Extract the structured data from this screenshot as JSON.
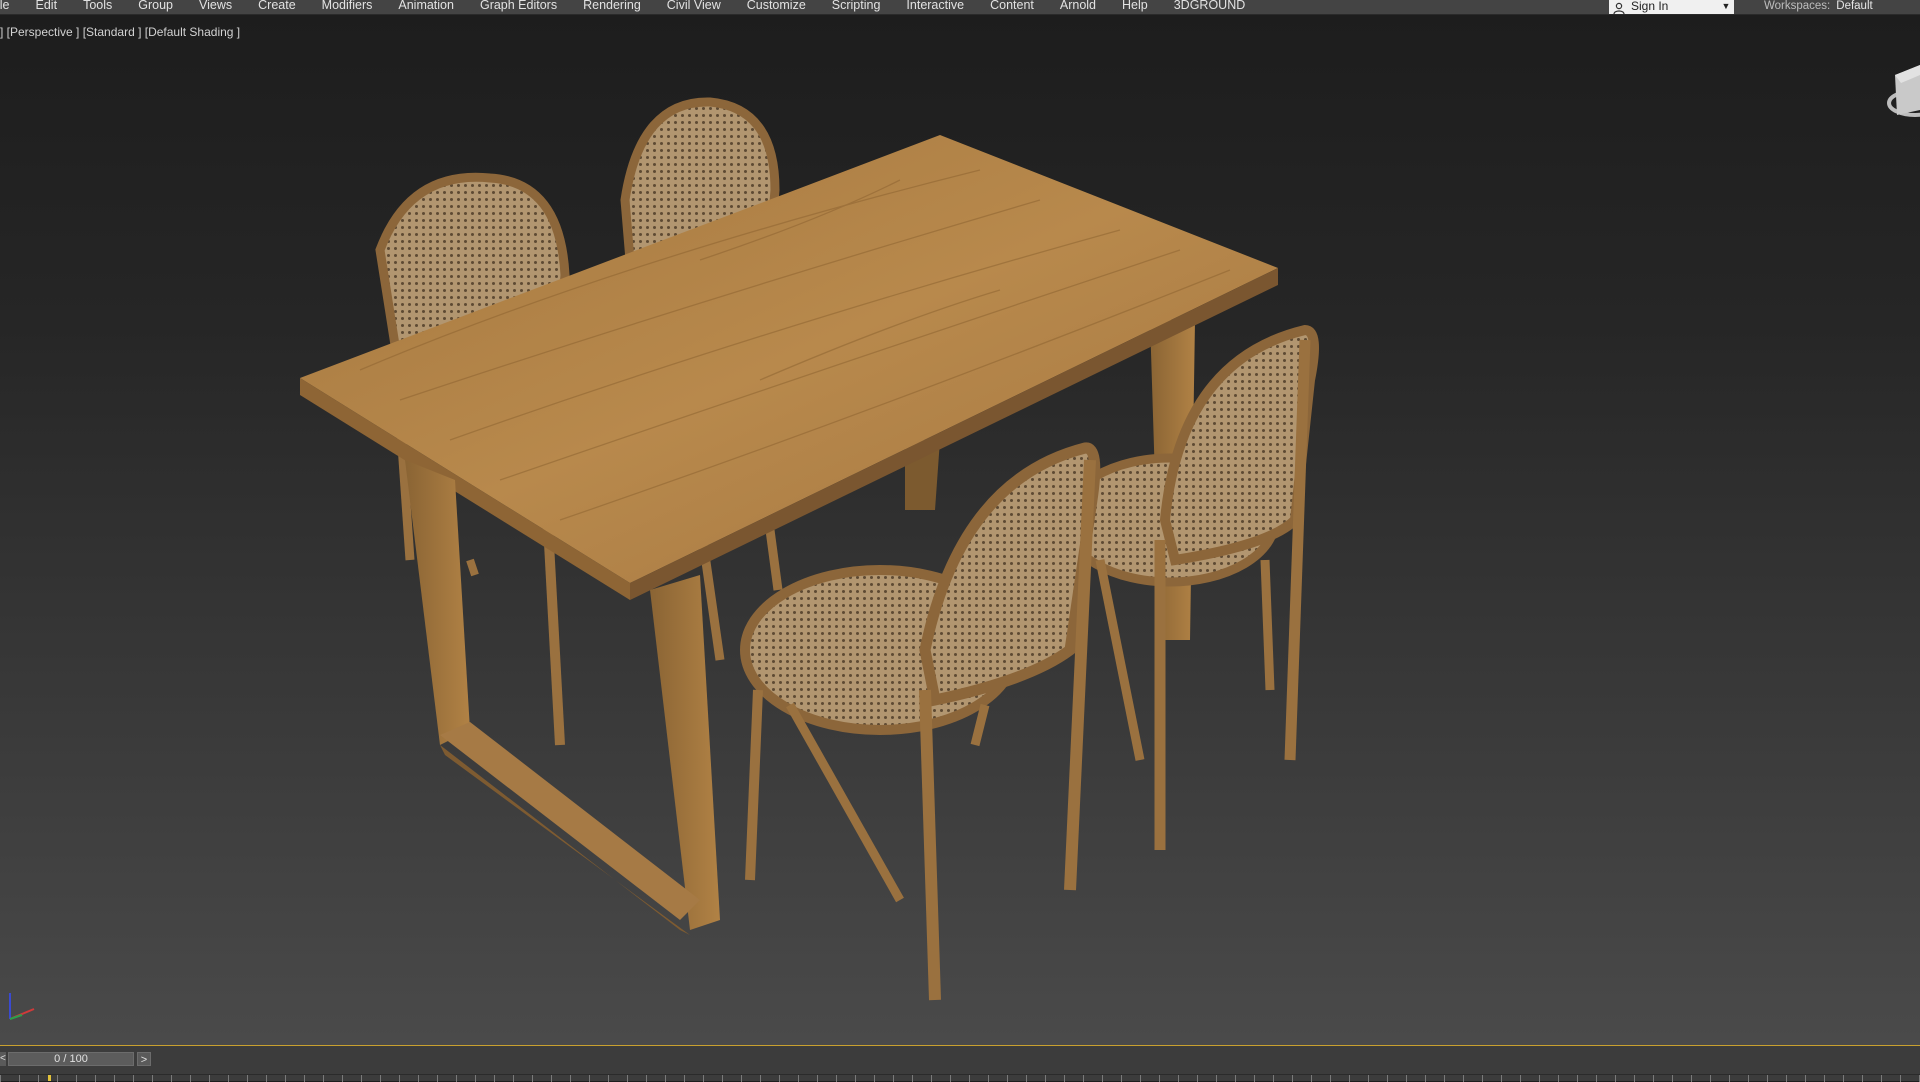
{
  "menu": {
    "items": [
      "ile",
      "Edit",
      "Tools",
      "Group",
      "Views",
      "Create",
      "Modifiers",
      "Animation",
      "Graph Editors",
      "Rendering",
      "Civil View",
      "Customize",
      "Scripting",
      "Interactive",
      "Content",
      "Arnold",
      "Help",
      "3DGROUND"
    ],
    "sign_in": "Sign In",
    "workspaces_label": "Workspaces:",
    "workspaces_value": "Default"
  },
  "viewport": {
    "label": "] [Perspective ] [Standard ] [Default Shading ]"
  },
  "timeline": {
    "frame_display": "0 / 100",
    "prev": "<",
    "next": ">"
  },
  "colors": {
    "wood": "#a67a45",
    "wood_dark": "#7d5a30",
    "cane": "#b59870",
    "accent_timeline": "#c9a12f"
  },
  "icons": [
    "user-icon",
    "chevron-down-icon",
    "viewcube-icon",
    "axis-gizmo-icon"
  ]
}
